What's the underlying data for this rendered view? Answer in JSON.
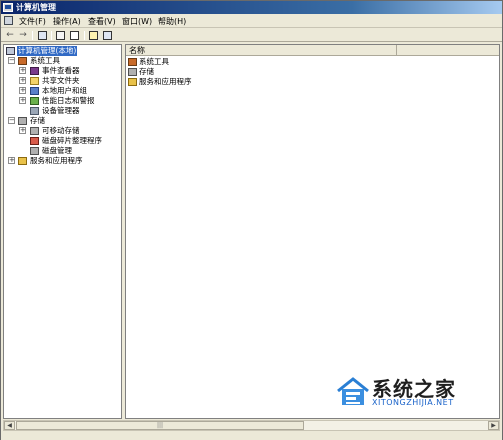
{
  "window": {
    "title": "计算机管理"
  },
  "menu": {
    "items": [
      {
        "label": "文件(F)"
      },
      {
        "label": "操作(A)"
      },
      {
        "label": "查看(V)"
      },
      {
        "label": "窗口(W)"
      },
      {
        "label": "帮助(H)"
      }
    ]
  },
  "toolbar": {
    "back": "←",
    "forward": "→"
  },
  "tree": {
    "root": {
      "label": "计算机管理(本地)",
      "expander": "−"
    },
    "nodes": [
      {
        "label": "系统工具",
        "expander": "−"
      },
      {
        "label": "事件查看器",
        "expander": "+"
      },
      {
        "label": "共享文件夹",
        "expander": "+"
      },
      {
        "label": "本地用户和组",
        "expander": "+"
      },
      {
        "label": "性能日志和警报",
        "expander": "+"
      },
      {
        "label": "设备管理器",
        "expander": ""
      },
      {
        "label": "存储",
        "expander": "−"
      },
      {
        "label": "可移动存储",
        "expander": "+"
      },
      {
        "label": "磁盘碎片整理程序",
        "expander": ""
      },
      {
        "label": "磁盘管理",
        "expander": ""
      },
      {
        "label": "服务和应用程序",
        "expander": "+"
      }
    ]
  },
  "list": {
    "column_header": "名称",
    "items": [
      {
        "label": "系统工具"
      },
      {
        "label": "存储"
      },
      {
        "label": "服务和应用程序"
      }
    ]
  },
  "scrollbar": {
    "left_arrow": "◀",
    "right_arrow": "▶",
    "thumb_grip": "|||"
  },
  "watermark": {
    "title": "系统之家",
    "subtitle": "XITONGZHIJIA.NET"
  }
}
